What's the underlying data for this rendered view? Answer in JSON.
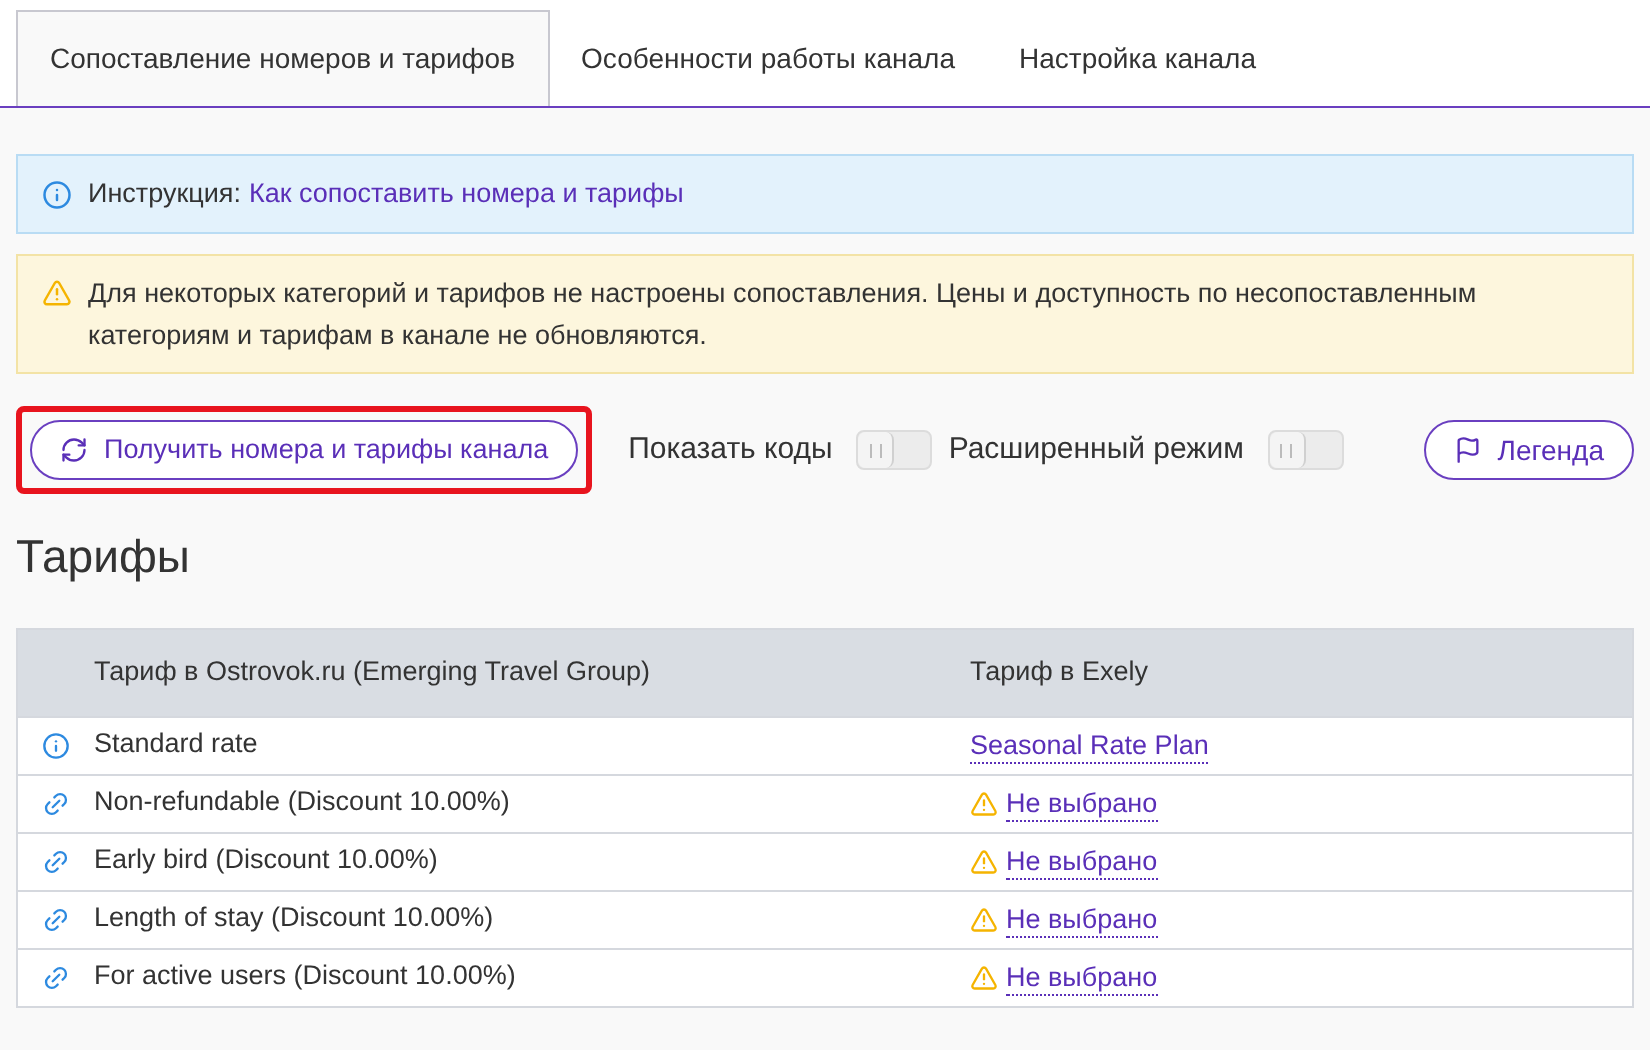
{
  "tabs": [
    {
      "label": "Сопоставление номеров и тарифов",
      "selected": true
    },
    {
      "label": "Особенности работы канала",
      "selected": false
    },
    {
      "label": "Настройка канала",
      "selected": false
    }
  ],
  "info_alert": {
    "label": "Инструкция:",
    "link": "Как сопоставить номера и тарифы"
  },
  "warning_alert": {
    "text": "Для некоторых категорий и тарифов не настроены сопоставления. Цены и доступность по несопоставленным категориям и тарифам в канале не обновляются."
  },
  "toolbar": {
    "fetch_button": {
      "label": "Получить номера и тарифы канала",
      "highlighted": true
    },
    "toggles": [
      {
        "label": "Показать коды",
        "on": false
      },
      {
        "label": "Расширенный режим",
        "on": false
      }
    ],
    "legend_button": "Легенда"
  },
  "section_title": "Тарифы",
  "table": {
    "columns": [
      "Тариф в Ostrovok.ru (Emerging Travel Group)",
      "Тариф в Exely"
    ],
    "rows": [
      {
        "kind": "info",
        "name": "Standard rate",
        "mapping": {
          "kind": "mapped",
          "text": "Seasonal Rate Plan"
        }
      },
      {
        "kind": "link",
        "name": "Non-refundable (Discount 10.00%)",
        "mapping": {
          "kind": "unmapped",
          "text": "Не выбрано"
        }
      },
      {
        "kind": "link",
        "name": "Early bird (Discount 10.00%)",
        "mapping": {
          "kind": "unmapped",
          "text": "Не выбрано"
        }
      },
      {
        "kind": "link",
        "name": "Length of stay (Discount 10.00%)",
        "mapping": {
          "kind": "unmapped",
          "text": "Не выбрано"
        }
      },
      {
        "kind": "link",
        "name": "For active users (Discount 10.00%)",
        "mapping": {
          "kind": "unmapped",
          "text": "Не выбрано"
        }
      }
    ]
  }
}
